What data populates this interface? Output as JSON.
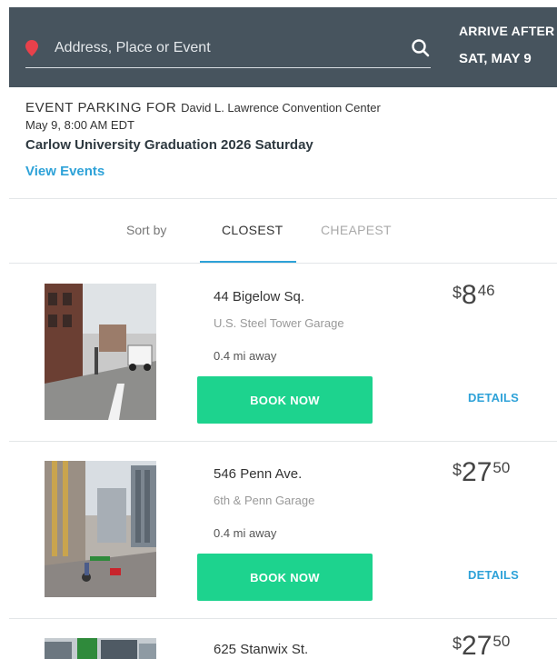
{
  "header": {
    "search_placeholder": "Address, Place or Event",
    "arrive_label": "ARRIVE AFTER",
    "arrive_date": "SAT, MAY 9"
  },
  "event": {
    "heading": "EVENT PARKING FOR",
    "venue": "David L. Lawrence Convention Center",
    "time": "May 9, 8:00 AM EDT",
    "name": "Carlow University Graduation 2026 Saturday",
    "view_events": "View Events"
  },
  "sort": {
    "label": "Sort by",
    "tabs": [
      {
        "label": "CLOSEST",
        "active": true
      },
      {
        "label": "CHEAPEST",
        "active": false
      }
    ]
  },
  "listings": [
    {
      "address": "44 Bigelow Sq.",
      "garage": "U.S. Steel Tower Garage",
      "distance": "0.4 mi away",
      "currency": "$",
      "dollars": "8",
      "cents": "46",
      "book_label": "BOOK NOW",
      "details_label": "DETAILS"
    },
    {
      "address": "546 Penn Ave.",
      "garage": "6th & Penn Garage",
      "distance": "0.4 mi away",
      "currency": "$",
      "dollars": "27",
      "cents": "50",
      "book_label": "BOOK NOW",
      "details_label": "DETAILS"
    },
    {
      "address": "625 Stanwix St.",
      "currency": "$",
      "dollars": "27",
      "cents": "50"
    }
  ],
  "colors": {
    "header_bg": "#47545e",
    "accent_blue": "#2ea2d8",
    "book_green": "#1dd38e",
    "pin_red": "#e8414b"
  },
  "icons": {
    "pin": "map-pin-icon",
    "search": "search-icon"
  }
}
